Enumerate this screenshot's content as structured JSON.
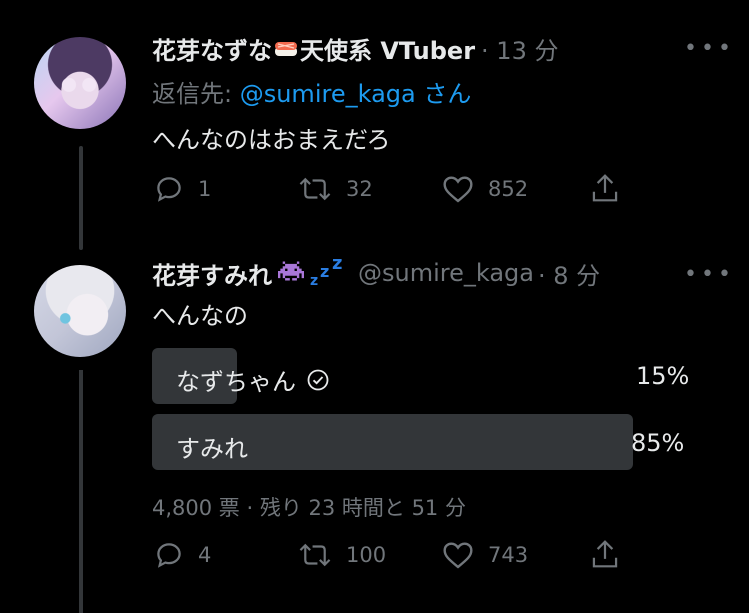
{
  "tweet1": {
    "display_name": "花芽なずな",
    "name_suffix": "天使系 VTuber",
    "time": "· 13 分",
    "reply_prefix": "返信先: ",
    "reply_handle": "@sumire_kaga",
    "reply_suffix": " さん",
    "body": "へんなのはおまえだろ",
    "replies": "1",
    "retweets": "32",
    "likes": "852"
  },
  "tweet2": {
    "display_name": "花芽すみれ",
    "handle": "@sumire_kaga",
    "time": "· 8 分",
    "body": "へんなの",
    "poll": {
      "options": [
        {
          "label": "なずちゃん",
          "percent": "15%",
          "fraction": 0.15,
          "selected": true
        },
        {
          "label": "すみれ",
          "percent": "85%",
          "fraction": 0.85,
          "selected": false
        }
      ],
      "summary": "4,800 票 · 残り 23 時間と 51 分"
    },
    "replies": "4",
    "retweets": "100",
    "likes": "743"
  },
  "colors": {
    "background": "#000000",
    "text": "#e7e9ea",
    "secondary": "#71767b",
    "link": "#1d9bf0",
    "poll_bar": "#333639"
  }
}
